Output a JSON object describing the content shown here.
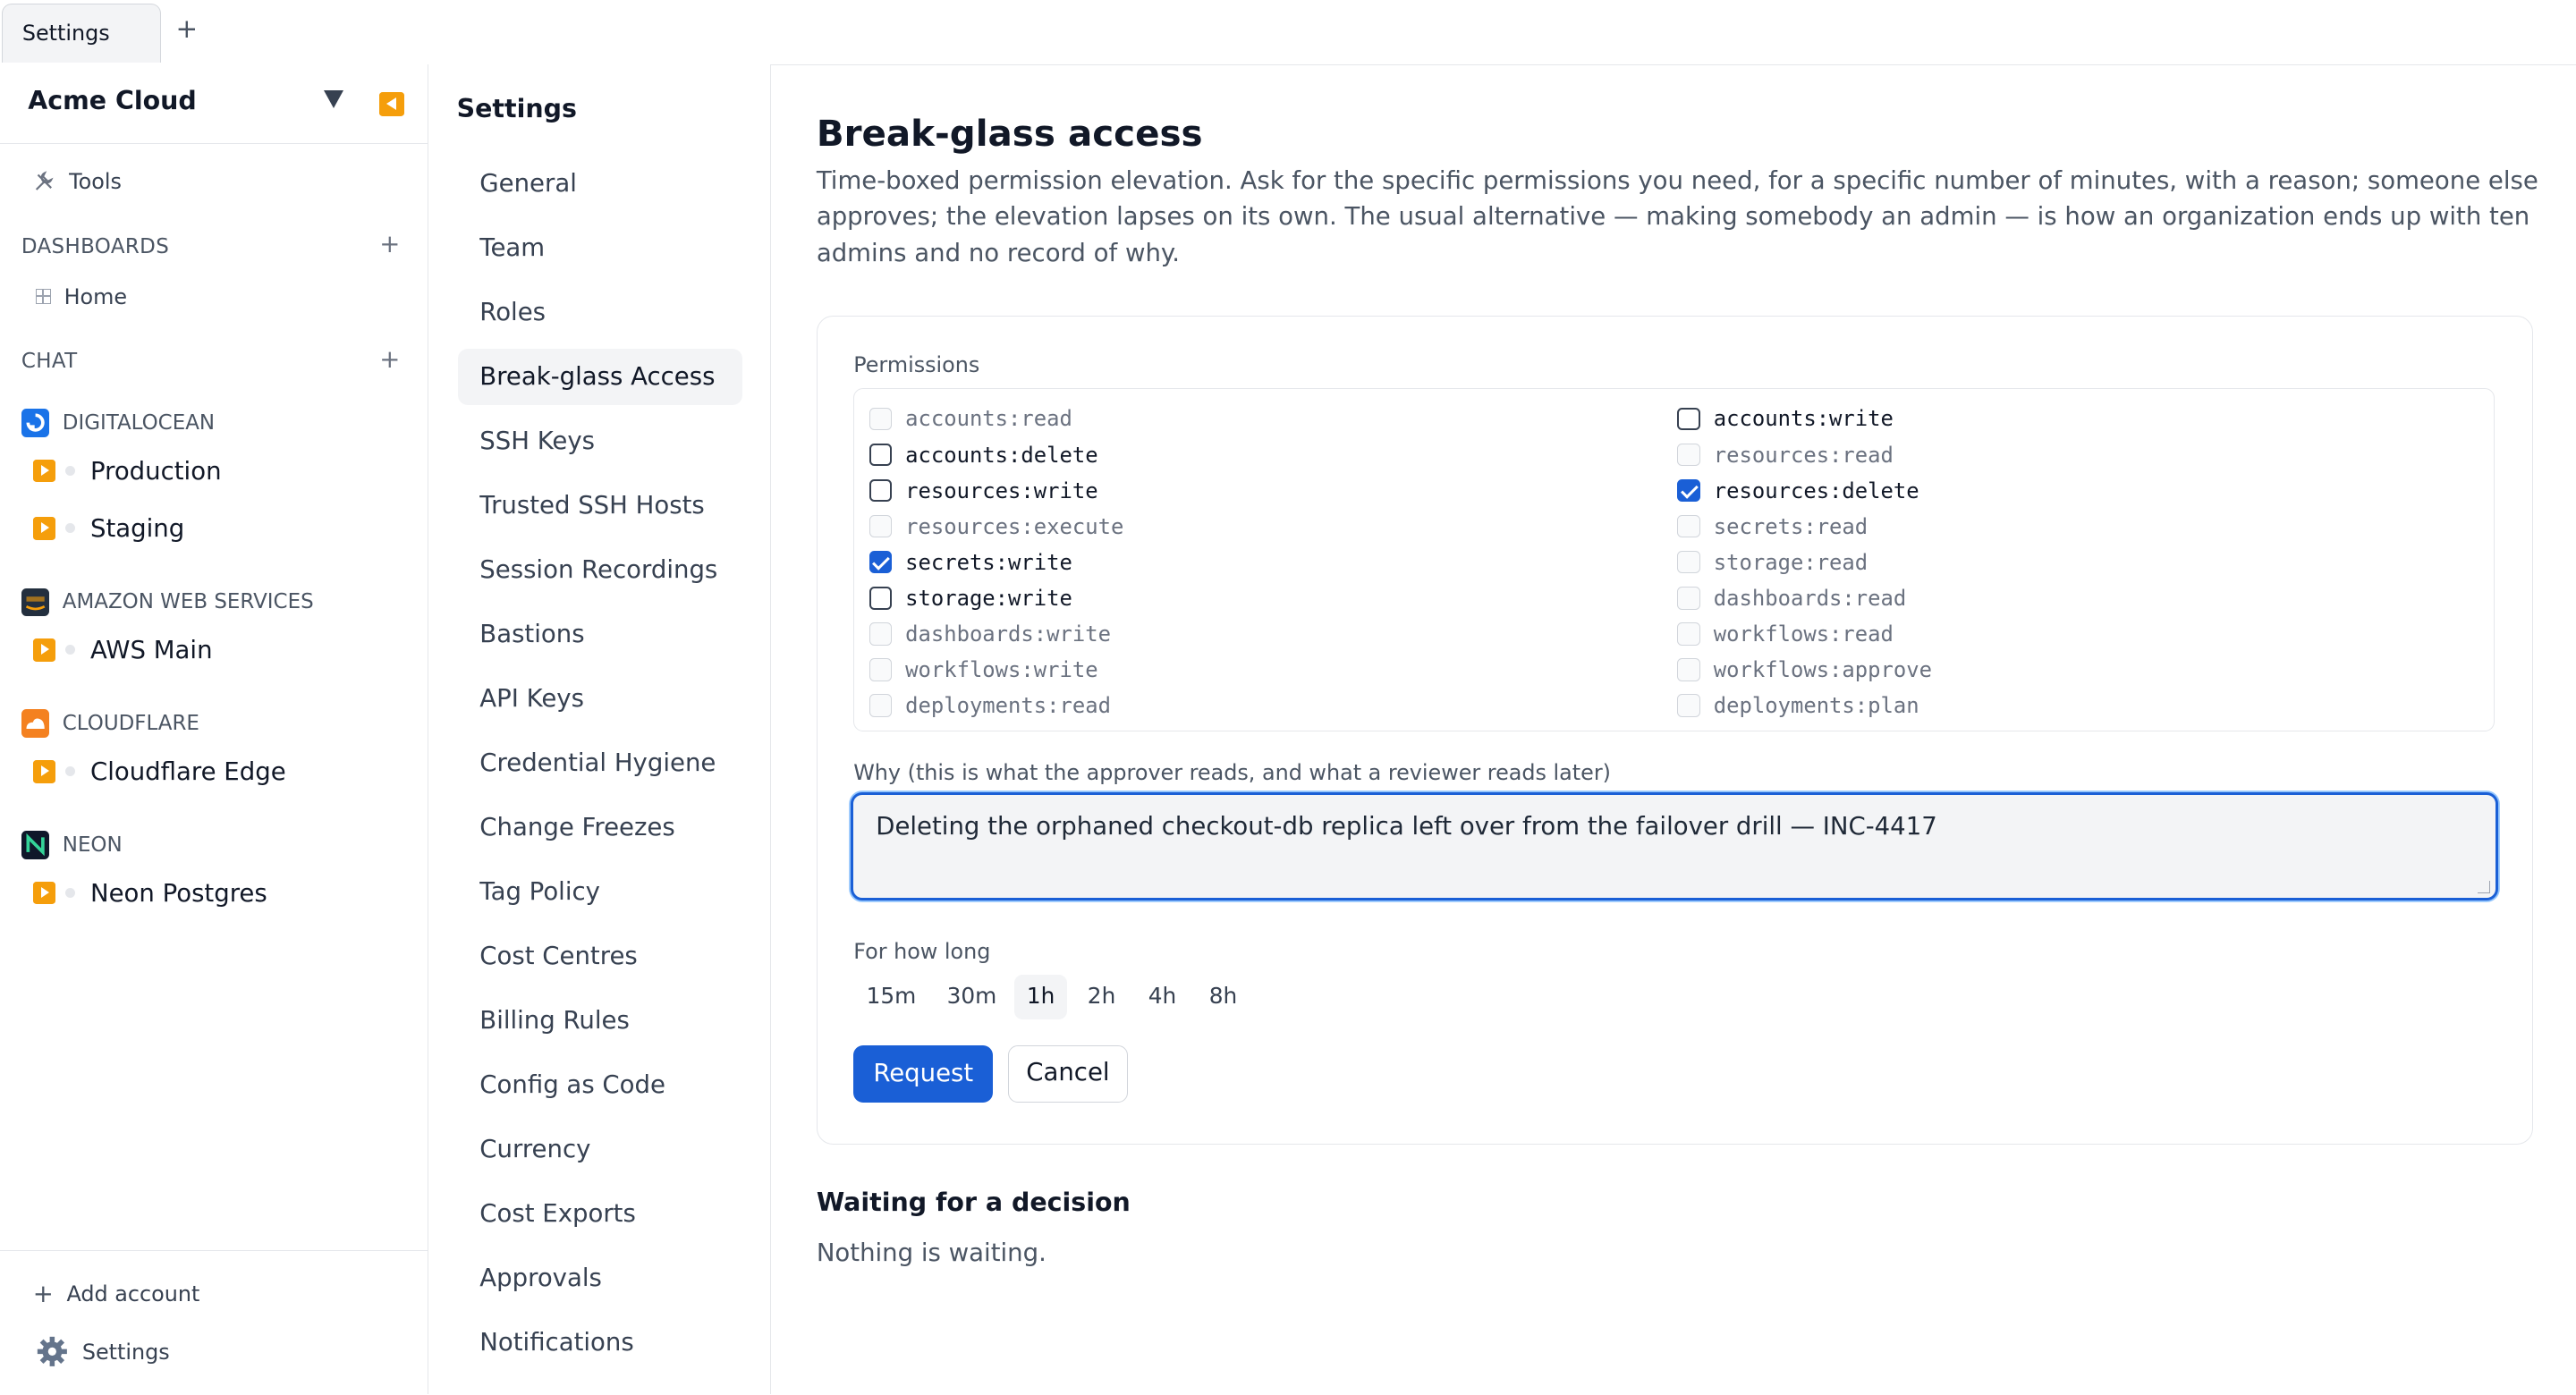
{
  "tabbar": {
    "tabs": [
      {
        "label": "Settings"
      }
    ],
    "add_label": "+"
  },
  "sidebar": {
    "org_name": "Acme Cloud",
    "tools_label": "Tools",
    "sections": {
      "dashboards": "DASHBOARDS",
      "chat": "CHAT",
      "plus": "+"
    },
    "home_label": "Home",
    "providers": [
      {
        "name": "DIGITALOCEAN",
        "icon": "digitalocean-icon",
        "color": "#1a73e8",
        "accounts": [
          "Production",
          "Staging"
        ]
      },
      {
        "name": "AMAZON WEB SERVICES",
        "icon": "aws-icon",
        "color": "#232f3e",
        "accounts": [
          "AWS Main"
        ]
      },
      {
        "name": "CLOUDFLARE",
        "icon": "cloudflare-icon",
        "color": "#f48120",
        "accounts": [
          "Cloudflare Edge"
        ]
      },
      {
        "name": "NEON",
        "icon": "neon-icon",
        "color": "#0f172a",
        "accounts": [
          "Neon Postgres"
        ]
      }
    ],
    "add_account_label": "Add account",
    "settings_label": "Settings"
  },
  "settings_nav": {
    "title": "Settings",
    "items": [
      "General",
      "Team",
      "Roles",
      "Break-glass Access",
      "SSH Keys",
      "Trusted SSH Hosts",
      "Session Recordings",
      "Bastions",
      "API Keys",
      "Credential Hygiene",
      "Change Freezes",
      "Tag Policy",
      "Cost Centres",
      "Billing Rules",
      "Config as Code",
      "Currency",
      "Cost Exports",
      "Approvals",
      "Notifications"
    ],
    "active": "Break-glass Access"
  },
  "main": {
    "title": "Break-glass access",
    "description": "Time-boxed permission elevation. Ask for the specific permissions you need, for a specific number of minutes, with a reason; someone else approves; the elevation lapses on its own. The usual alternative — making somebody an admin — is how an organization ends up with ten admins and no record of why.",
    "permissions_label": "Permissions",
    "permissions": {
      "left": [
        {
          "name": "accounts:read",
          "state": "disabled"
        },
        {
          "name": "accounts:delete",
          "state": "unchecked"
        },
        {
          "name": "resources:write",
          "state": "unchecked"
        },
        {
          "name": "resources:execute",
          "state": "disabled"
        },
        {
          "name": "secrets:write",
          "state": "checked"
        },
        {
          "name": "storage:write",
          "state": "unchecked"
        },
        {
          "name": "dashboards:write",
          "state": "disabled"
        },
        {
          "name": "workflows:write",
          "state": "disabled"
        },
        {
          "name": "deployments:read",
          "state": "disabled"
        }
      ],
      "right": [
        {
          "name": "accounts:write",
          "state": "unchecked"
        },
        {
          "name": "resources:read",
          "state": "disabled"
        },
        {
          "name": "resources:delete",
          "state": "checked"
        },
        {
          "name": "secrets:read",
          "state": "disabled"
        },
        {
          "name": "storage:read",
          "state": "disabled"
        },
        {
          "name": "dashboards:read",
          "state": "disabled"
        },
        {
          "name": "workflows:read",
          "state": "disabled"
        },
        {
          "name": "workflows:approve",
          "state": "disabled"
        },
        {
          "name": "deployments:plan",
          "state": "disabled"
        }
      ]
    },
    "why_label": "Why (this is what the approver reads, and what a reviewer reads later)",
    "why_value": "Deleting the orphaned checkout-db replica left over from the failover drill — INC-4417",
    "duration_label": "For how long",
    "durations": [
      "15m",
      "30m",
      "1h",
      "2h",
      "4h",
      "8h"
    ],
    "selected_duration": "1h",
    "request_label": "Request",
    "cancel_label": "Cancel",
    "waiting_title": "Waiting for a decision",
    "waiting_empty": "Nothing is waiting.",
    "accent_color": "#1a5fd6"
  }
}
